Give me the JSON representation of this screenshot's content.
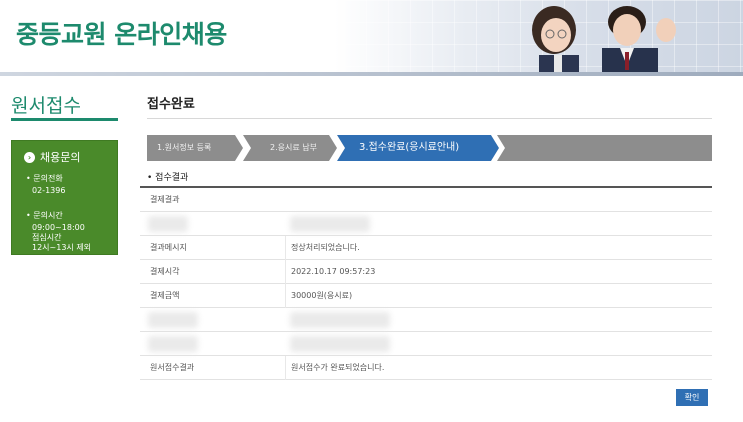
{
  "header": {
    "site_title": "중등교원 온라인채용"
  },
  "sidebar": {
    "title": "원서접수",
    "box_title": "채용문의",
    "phone_label": "• 문의전화",
    "phone_value": "02-1396",
    "hours_label": "• 문의시간",
    "hours_value": "09:00~18:00",
    "lunch_label": "점심시간",
    "lunch_value": "12시~13시 제외"
  },
  "main": {
    "page_title": "접수완료",
    "steps": [
      {
        "label": "1.원서정보 등록"
      },
      {
        "label": "2.응시료 납부"
      },
      {
        "label": "3.접수완료(응시료안내)"
      }
    ],
    "section_label": "• 접수결과",
    "rows": [
      {
        "label": "결제결과",
        "value": ""
      },
      {
        "label": "",
        "value": ""
      },
      {
        "label": "결과메시지",
        "value": "정상처리되었습니다."
      },
      {
        "label": "결제시각",
        "value": "2022.10.17 09:57:23"
      },
      {
        "label": "결제금액",
        "value": "30000원(응시료)"
      },
      {
        "label": "",
        "value": ""
      },
      {
        "label": "",
        "value": ""
      },
      {
        "label": "원서접수결과",
        "value": "원서접수가 완료되었습니다."
      }
    ],
    "confirm_label": "확인"
  },
  "colors": {
    "brand_green": "#1d8a6d",
    "side_box": "#4a8a2a",
    "active_step": "#2f6fb4",
    "step_gray": "#8d8d8d"
  }
}
